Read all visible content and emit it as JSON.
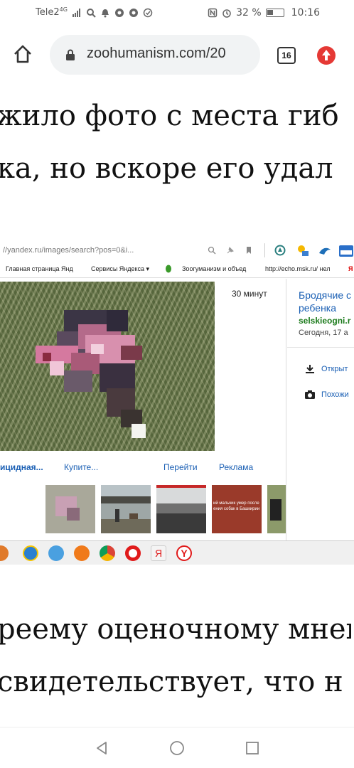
{
  "status_bar": {
    "carrier": "Tele2",
    "network": "4G",
    "battery": "32 %",
    "time": "10:16"
  },
  "browser": {
    "url": "zoohumanism.com/20",
    "tab_count": "16"
  },
  "article": {
    "line1": "жило фото с места гиб",
    "line2": "ка, но вскоре его удал",
    "line3": "реему оценочному мнен",
    "line4": "свидетельствует, что н"
  },
  "embedded_screenshot": {
    "address": "//yandex.ru/images/search?pos=0&i...",
    "bookmarks": [
      "Главная страница Янд",
      "Сервисы Яндекса ▾",
      "Зоогуманизм и объед",
      "http://echo.msk.ru/ нел",
      "Я"
    ],
    "time_ago": "30 минут",
    "result_title_line1": "Бродячие с",
    "result_title_line2": "ребенка",
    "result_site": "selskieogni.r",
    "result_date": "Сегодня, 17 а",
    "action_open": "Открыт",
    "action_similar": "Похожи",
    "links": [
      "ицидная...",
      "Купите...",
      "Перейти",
      "Реклама"
    ],
    "thumb_caption": "ий мальчик умер после\nения собак в Башкирии"
  }
}
